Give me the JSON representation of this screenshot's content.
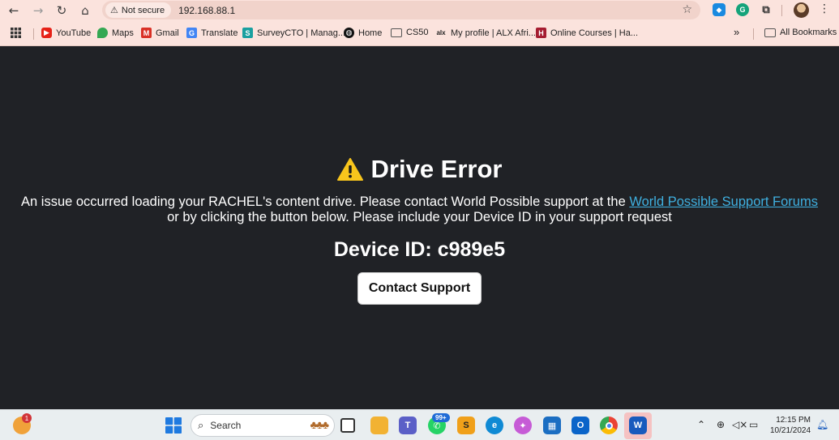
{
  "browser": {
    "url": "192.168.88.1",
    "security_label": "Not secure",
    "bookmarks": [
      {
        "label": "YouTube",
        "icon": "youtube-icon",
        "color": "#e62117"
      },
      {
        "label": "Maps",
        "icon": "maps-icon",
        "color": "#34a853"
      },
      {
        "label": "Gmail",
        "icon": "gmail-icon",
        "color": "#d93025"
      },
      {
        "label": "Translate",
        "icon": "translate-icon",
        "color": "#4285f4"
      },
      {
        "label": "SurveyCTO | Manag...",
        "icon": "surveycto-icon",
        "color": "#1aa0a0"
      },
      {
        "label": "Home",
        "icon": "home-icon",
        "color": "#111111"
      },
      {
        "label": "CS50",
        "icon": "folder-icon",
        "color": "#555555"
      },
      {
        "label": "My profile | ALX Afri...",
        "icon": "alx-icon",
        "color": "#222222"
      },
      {
        "label": "Online Courses | Ha...",
        "icon": "harvard-icon",
        "color": "#a51c30"
      }
    ],
    "all_bookmarks_label": "All Bookmarks",
    "overflow_label": "»"
  },
  "page": {
    "title": "Drive Error",
    "message_part1": "An issue occurred loading your RACHEL's content drive. Please contact World Possible support at the ",
    "link_text": "World Possible Support Forums",
    "message_part2": " or by clicking the button below. Please include your Device ID in your support request",
    "device_id_label": "Device ID: c989e5",
    "button_label": "Contact Support",
    "link_color": "#3fb0e0",
    "background_color": "#202226"
  },
  "taskbar": {
    "search_placeholder": "Search",
    "weather_badge": "1",
    "teams_badge": "99+",
    "time": "12:15 PM",
    "date": "10/21/2024"
  }
}
